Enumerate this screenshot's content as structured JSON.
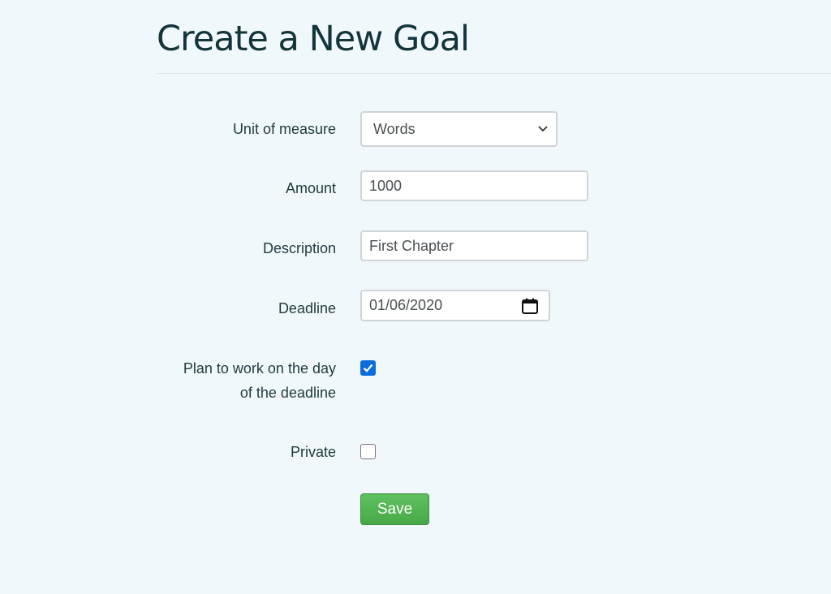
{
  "page": {
    "title": "Create a New Goal"
  },
  "form": {
    "unit": {
      "label": "Unit of measure",
      "value": "Words"
    },
    "amount": {
      "label": "Amount",
      "value": "1000"
    },
    "description": {
      "label": "Description",
      "value": "First Chapter"
    },
    "deadline": {
      "label": "Deadline",
      "value": "01/06/2020"
    },
    "plan_deadline_day": {
      "label_line1": "Plan to work on the day",
      "label_line2": "of the deadline",
      "checked": true
    },
    "private": {
      "label": "Private",
      "checked": false
    },
    "save_label": "Save"
  },
  "colors": {
    "background": "#f1f8fc",
    "title": "#12353a",
    "save_button": "#4cae4c",
    "checkbox_checked": "#0b6cdc"
  },
  "icons": {
    "select": "chevron-down-icon",
    "date": "calendar-icon",
    "checked": "check-icon"
  }
}
